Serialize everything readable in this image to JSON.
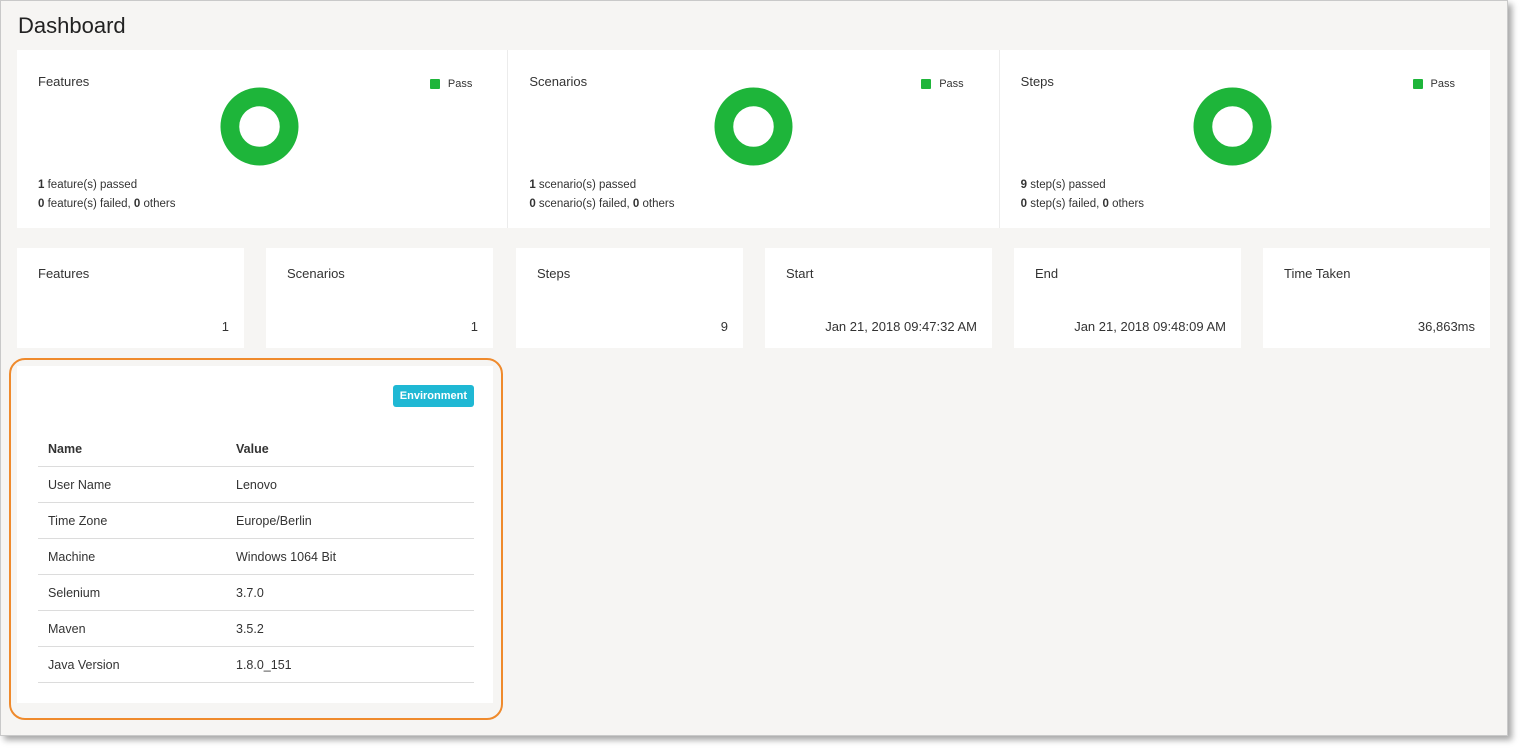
{
  "page": {
    "title": "Dashboard"
  },
  "colors": {
    "pass": "#1eb53a",
    "badge": "#1fb8d4",
    "highlight": "#ef8a2c"
  },
  "donut_cards": [
    {
      "title": "Features",
      "legend": "Pass",
      "line1_count": "1",
      "line1_text": " feature(s) passed",
      "line2_count": "0",
      "line2_mid": " feature(s) failed, ",
      "line2_others": "0",
      "line2_tail": " others",
      "pass_fraction": 1.0
    },
    {
      "title": "Scenarios",
      "legend": "Pass",
      "line1_count": "1",
      "line1_text": " scenario(s) passed",
      "line2_count": "0",
      "line2_mid": " scenario(s) failed, ",
      "line2_others": "0",
      "line2_tail": " others",
      "pass_fraction": 1.0
    },
    {
      "title": "Steps",
      "legend": "Pass",
      "line1_count": "9",
      "line1_text": " step(s) passed",
      "line2_count": "0",
      "line2_mid": " step(s) failed, ",
      "line2_others": "0",
      "line2_tail": " others",
      "pass_fraction": 1.0
    }
  ],
  "stat_cards": [
    {
      "title": "Features",
      "value": "1"
    },
    {
      "title": "Scenarios",
      "value": "1"
    },
    {
      "title": "Steps",
      "value": "9"
    },
    {
      "title": "Start",
      "value": "Jan 21, 2018 09:47:32 AM"
    },
    {
      "title": "End",
      "value": "Jan 21, 2018 09:48:09 AM"
    },
    {
      "title": "Time Taken",
      "value": "36,863ms"
    }
  ],
  "environment": {
    "badge": "Environment",
    "columns": [
      "Name",
      "Value"
    ],
    "rows": [
      [
        "User Name",
        "Lenovo"
      ],
      [
        "Time Zone",
        "Europe/Berlin"
      ],
      [
        "Machine",
        "Windows 1064 Bit"
      ],
      [
        "Selenium",
        "3.7.0"
      ],
      [
        "Maven",
        "3.5.2"
      ],
      [
        "Java Version",
        "1.8.0_151"
      ]
    ]
  }
}
